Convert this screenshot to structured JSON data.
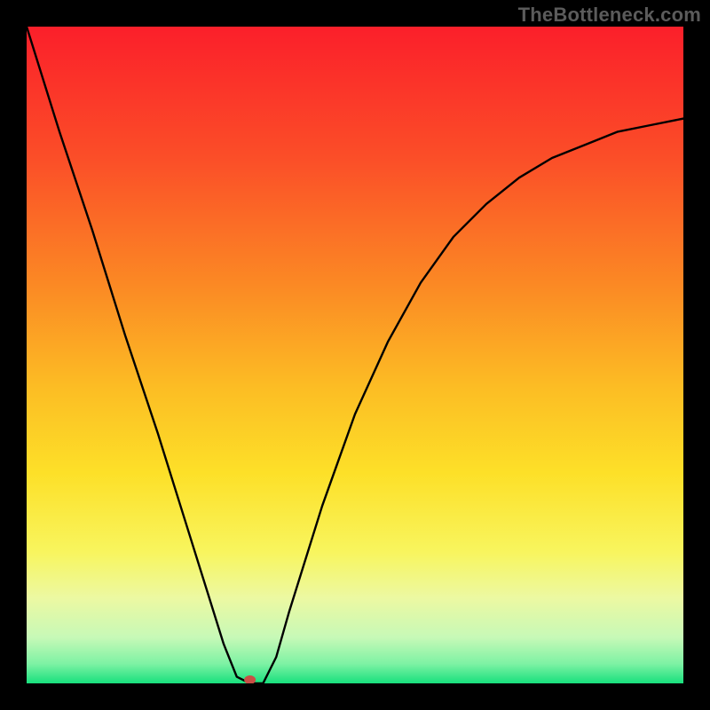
{
  "watermark": "TheBottleneck.com",
  "chart_data": {
    "type": "line",
    "title": "",
    "xlabel": "",
    "ylabel": "",
    "xlim": [
      0,
      100
    ],
    "ylim": [
      0,
      100
    ],
    "grid": false,
    "legend": false,
    "series": [
      {
        "name": "curve",
        "x": [
          0,
          5,
          10,
          15,
          20,
          25,
          27.5,
          30,
          32,
          34,
          36,
          38,
          40,
          45,
          50,
          55,
          60,
          65,
          70,
          75,
          80,
          85,
          90,
          95,
          100
        ],
        "y": [
          100,
          84,
          69,
          53,
          38,
          22,
          14,
          6,
          1,
          0,
          0,
          4,
          11,
          27,
          41,
          52,
          61,
          68,
          73,
          77,
          80,
          82,
          84,
          85,
          86
        ]
      }
    ],
    "marker": {
      "x": 34,
      "y": 0,
      "color": "#c94f45"
    },
    "background_gradient": {
      "stops": [
        {
          "offset": 0.0,
          "color": "#fb1f2a"
        },
        {
          "offset": 0.2,
          "color": "#fb4e28"
        },
        {
          "offset": 0.4,
          "color": "#fb8b24"
        },
        {
          "offset": 0.55,
          "color": "#fcbd24"
        },
        {
          "offset": 0.68,
          "color": "#fde028"
        },
        {
          "offset": 0.8,
          "color": "#f8f55e"
        },
        {
          "offset": 0.87,
          "color": "#ecf9a2"
        },
        {
          "offset": 0.93,
          "color": "#c7f9b7"
        },
        {
          "offset": 0.97,
          "color": "#7ef2a4"
        },
        {
          "offset": 1.0,
          "color": "#18e07d"
        }
      ]
    }
  }
}
